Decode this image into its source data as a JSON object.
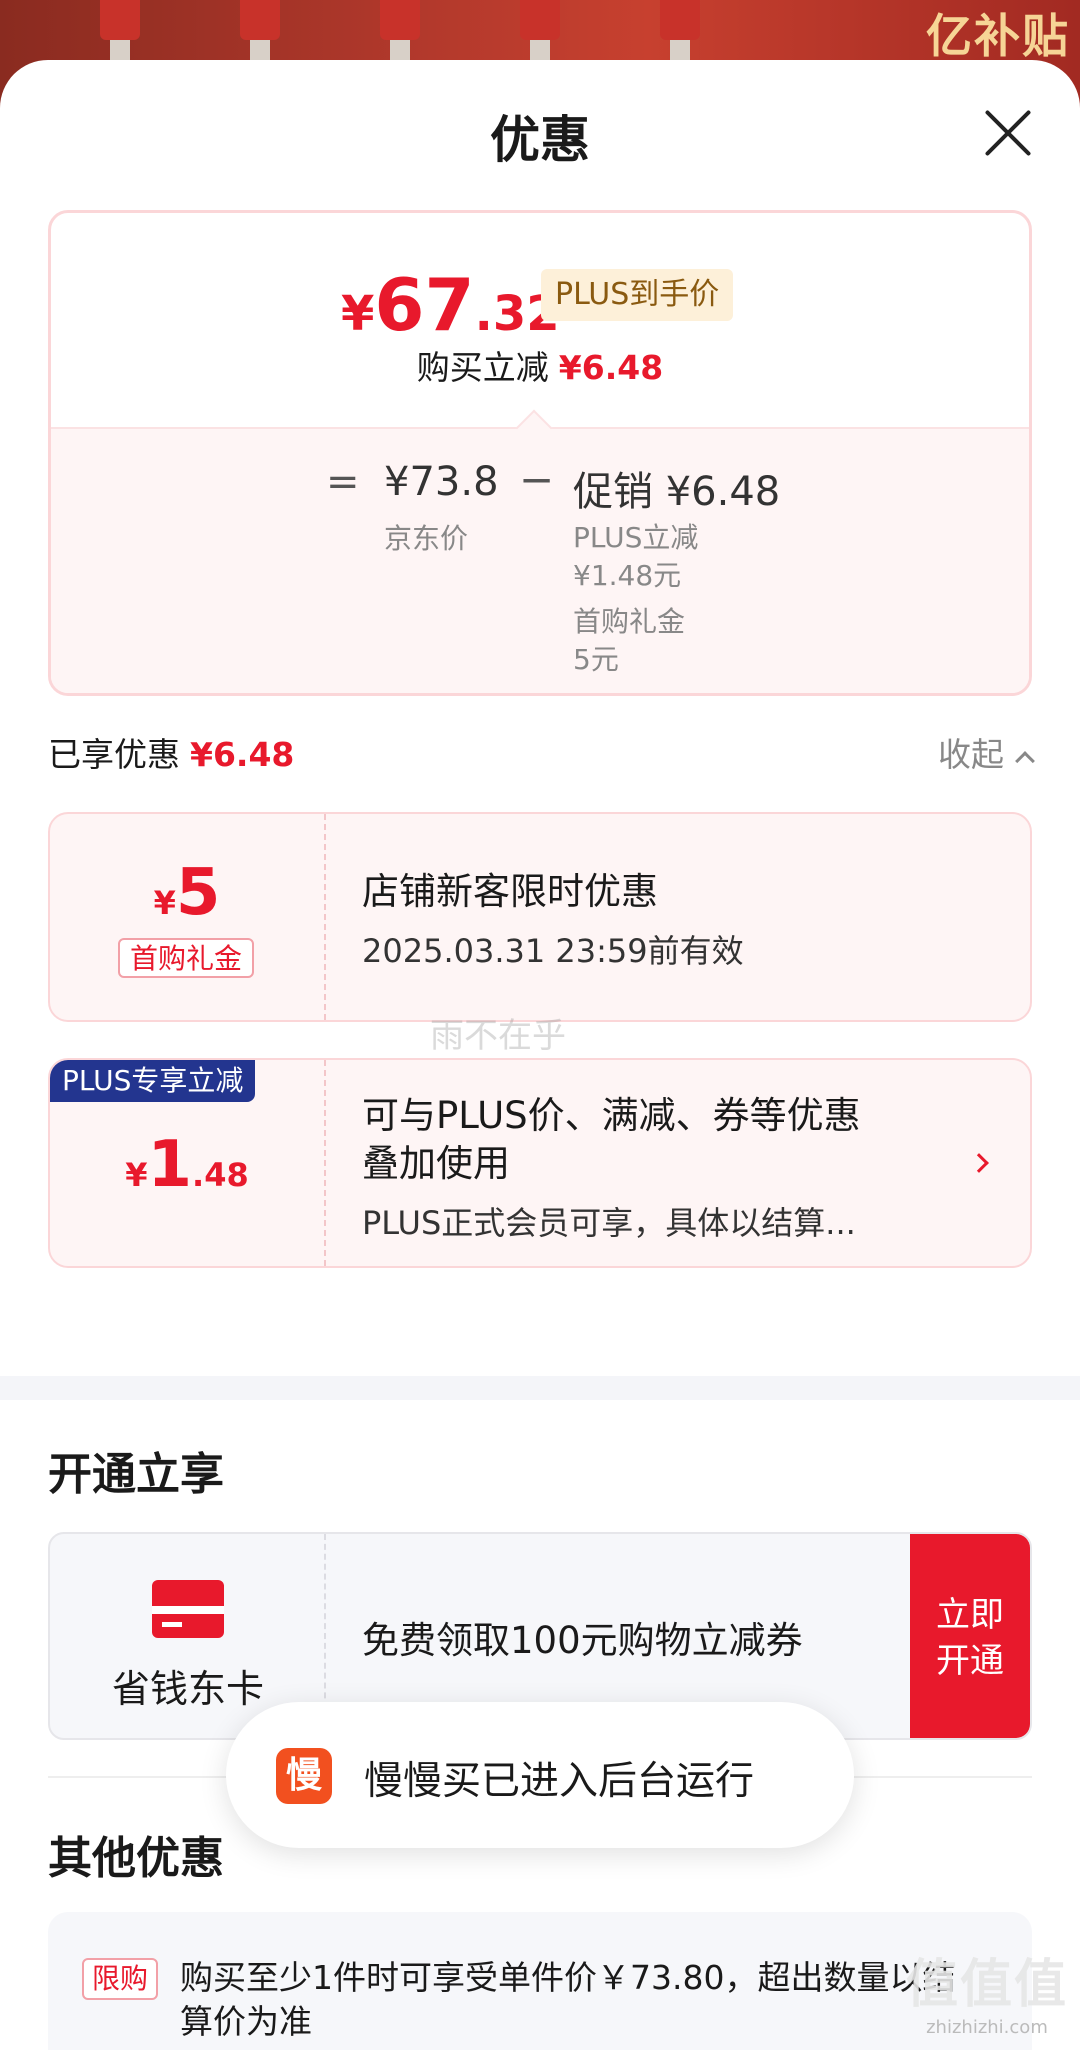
{
  "banner": {
    "text": "亿补贴"
  },
  "header": {
    "title": "优惠"
  },
  "summary": {
    "currency": "¥",
    "price_int": "67",
    "price_dec": ".32",
    "plus_tag": "PLUS到手价",
    "instant_label": "购买立减",
    "instant_amount": "¥6.48",
    "eq": "=",
    "jd_price": "¥73.8",
    "jd_label": "京东价",
    "minus": "−",
    "promo": "促销 ¥6.48",
    "promo_lines": [
      "PLUS立减",
      "¥1.48元",
      "首购礼金",
      "5元"
    ]
  },
  "enjoyed": {
    "label": "已享优惠",
    "amount": "¥6.48",
    "collapse": "收起"
  },
  "coupons": [
    {
      "currency": "¥",
      "int": "5",
      "dec": "",
      "kind": "首购礼金",
      "title": "店铺新客限时优惠",
      "sub": "2025.03.31 23:59前有效"
    },
    {
      "ribbon": "PLUS专享立减",
      "currency": "¥",
      "int": "1",
      "dec": ".48",
      "title_line1": "可与PLUS价、满减、券等优惠",
      "title_line2": "叠加使用",
      "sub": "PLUS正式会员可享，具体以结算..."
    }
  ],
  "watermark": "雨不在乎",
  "open_section": {
    "title": "开通立享",
    "card_name": "省钱东卡",
    "desc": "免费领取100元购物立减券",
    "button_line1": "立即",
    "button_line2": "开通"
  },
  "toast": {
    "icon_char": "慢",
    "text": "慢慢买已进入后台运行"
  },
  "other_section": {
    "title": "其他优惠",
    "tag": "限购",
    "text": "购买至少1件时可享受单件价￥73.80，超出数量以结算价为准"
  },
  "corner_watermark": {
    "big": "值值值",
    "small": "zhizhizhi.com"
  },
  "colors": {
    "accent": "#e8192c",
    "plus_blue": "#23358f"
  }
}
